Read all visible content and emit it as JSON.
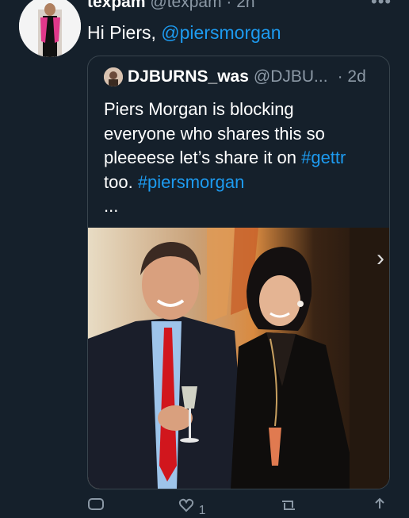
{
  "tweet": {
    "author_name": "texpam",
    "author_handle": "@texpam",
    "time": "· 2h",
    "text_prefix": "Hi Piers, ",
    "mention": "@piersmorgan"
  },
  "quoted": {
    "author_name": "DJBURNS_was",
    "author_handle": "@DJBU...",
    "time": "· 2d",
    "lines": [
      "Piers Morgan is blocking",
      "everyone who shares this so",
      "pleeeese let’s share it on "
    ],
    "hashtag_gettr": "#gettr",
    "line4_prefix": "too. ",
    "hashtag_piers": "#piersmorgan",
    "ellipsis": "..."
  },
  "actions": {
    "like_count": "1"
  },
  "icons": {
    "more": "more-dots-icon",
    "next": "chevron-right-icon",
    "reply": "reply-icon",
    "like": "like-icon",
    "retweet": "retweet-icon",
    "share": "share-icon"
  },
  "colors": {
    "background": "#15202b",
    "link": "#1d9bf0",
    "muted": "#8b98a5"
  }
}
